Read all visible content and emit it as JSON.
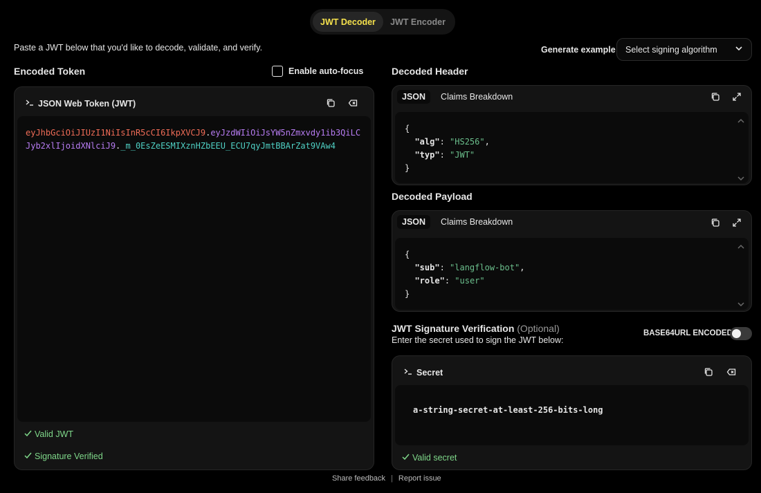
{
  "tabs": {
    "decoder": "JWT Decoder",
    "encoder": "JWT Encoder"
  },
  "intro": "Paste a JWT below that you'd like to decode, validate, and verify.",
  "generate": {
    "label": "Generate example",
    "select_value": "Select signing algorithm"
  },
  "encoded": {
    "title": "Encoded Token",
    "autofocus_label": "Enable auto-focus",
    "panel_label": "JSON Web Token (JWT)",
    "token_header": "eyJhbGciOiJIUzI1NiIsInR5cCI6IkpXVCJ9",
    "token_payload": "eyJzdWIiOiJsYW5nZmxvdy1ib3QiLCJyb2xlIjoidXNlciJ9",
    "token_signature": "_m_0EsZeESMIXznHZbEEU_ECU7qyJmtBBArZat9VAw4",
    "dot": ".",
    "status_valid": "Valid JWT",
    "status_verified": "Signature Verified"
  },
  "header": {
    "title": "Decoded Header",
    "tab_json": "JSON",
    "tab_claims": "Claims Breakdown",
    "code": {
      "open": "{",
      "close": "}",
      "k1": "\"alg\"",
      "v1": "\"HS256\"",
      "k2": "\"typ\"",
      "v2": "\"JWT\""
    }
  },
  "payload": {
    "title": "Decoded Payload",
    "tab_json": "JSON",
    "tab_claims": "Claims Breakdown",
    "code": {
      "open": "{",
      "close": "}",
      "k1": "\"sub\"",
      "v1": "\"langflow-bot\"",
      "k2": "\"role\"",
      "v2": "\"user\""
    }
  },
  "signature": {
    "title": "JWT Signature Verification",
    "optional": "(Optional)",
    "subtitle": "Enter the secret used to sign the JWT below:",
    "b64_label": "BASE64URL ENCODED",
    "panel_label": "Secret",
    "secret_value": "a-string-secret-at-least-256-bits-long",
    "status": "Valid secret"
  },
  "footer": {
    "feedback": "Share feedback",
    "sep": "|",
    "report": "Report issue"
  },
  "colors": {
    "accent": "#f5e14c",
    "header_seg": "#f06c57",
    "payload_seg": "#b77cf2",
    "signature_seg": "#4fd0c4",
    "success": "#7fd88a"
  }
}
